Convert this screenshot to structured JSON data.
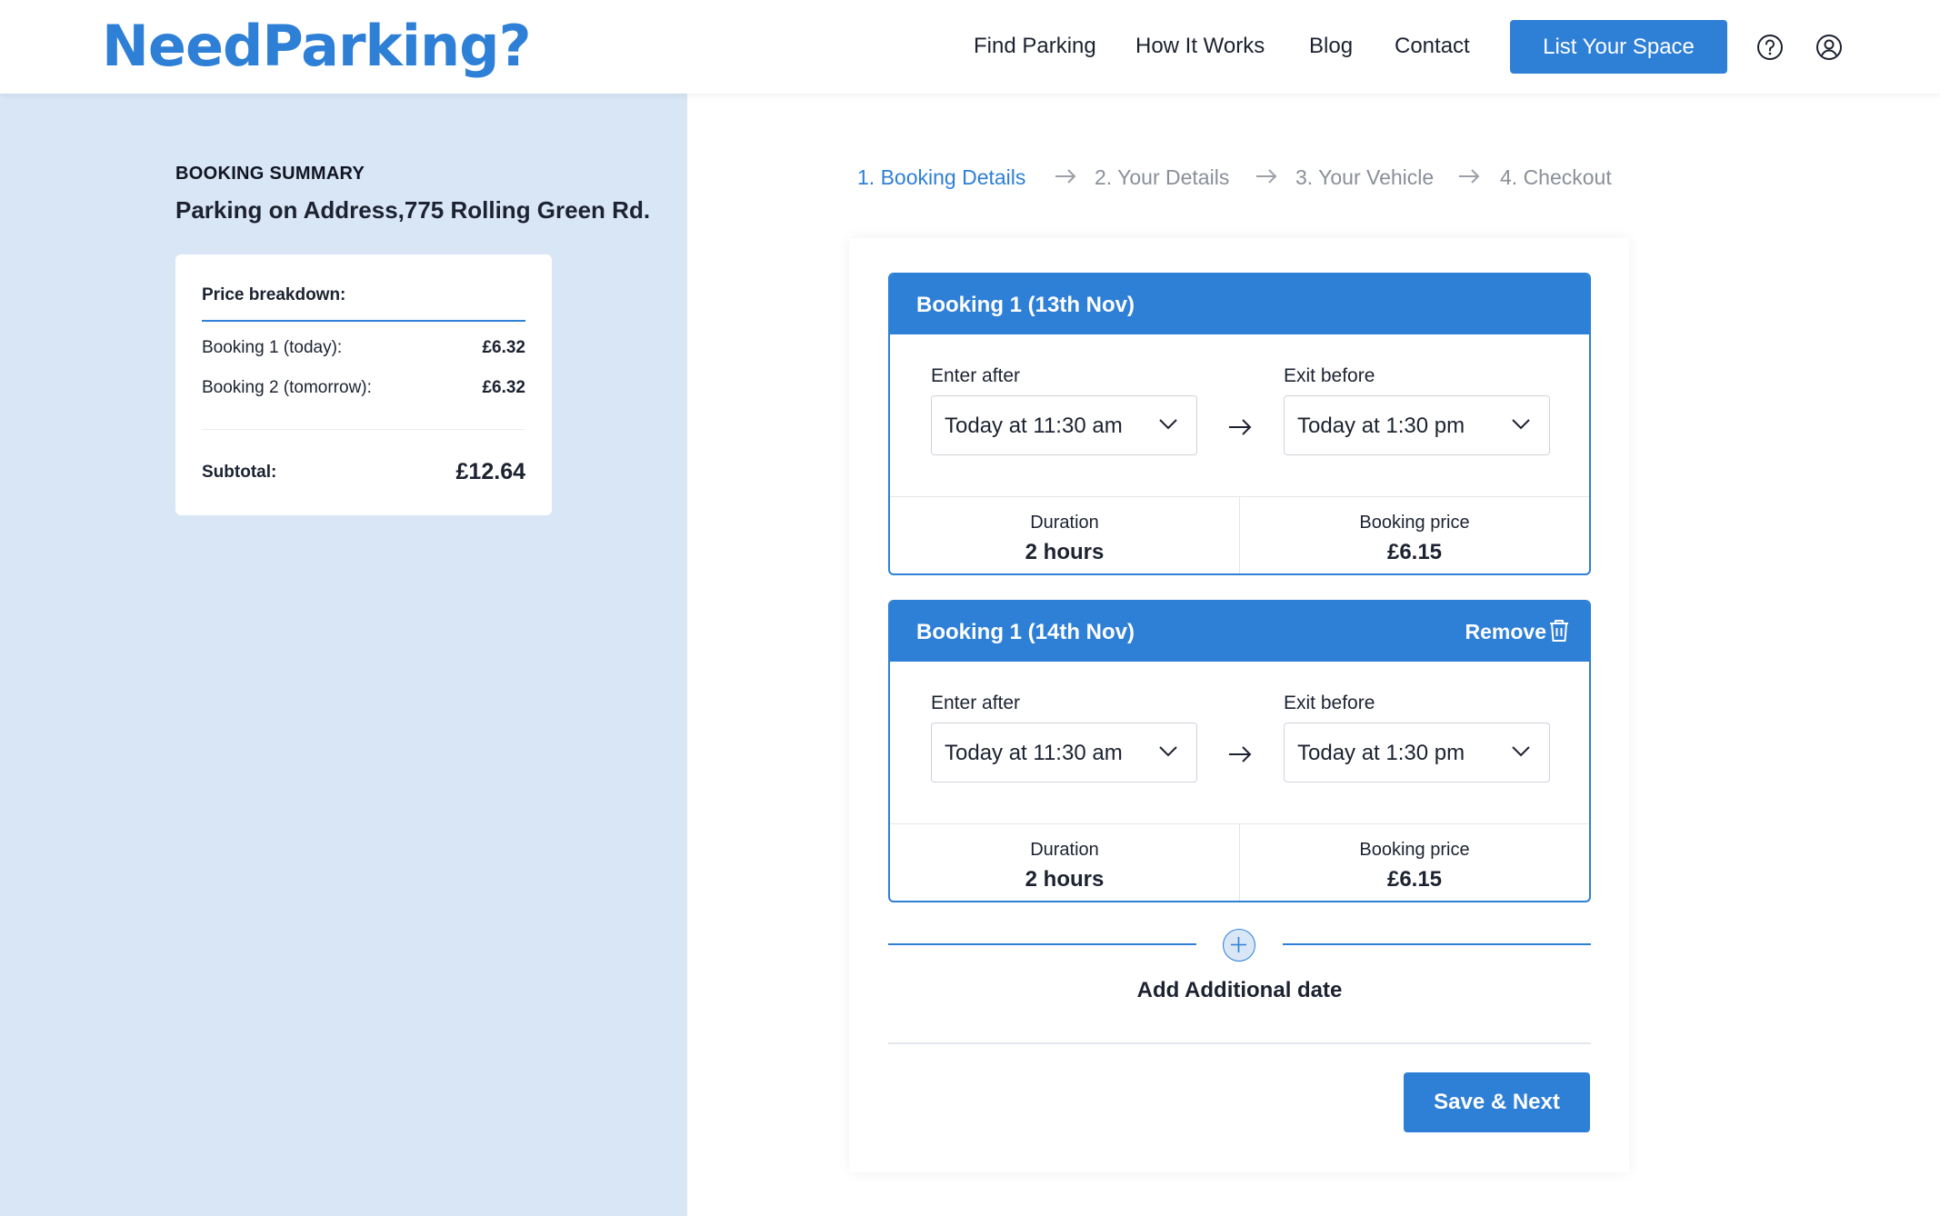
{
  "header": {
    "logo": "NeedParking?",
    "nav": [
      "Find Parking",
      "How It Works",
      "Blog",
      "Contact"
    ],
    "cta": "List Your Space",
    "icons": [
      "help-icon",
      "account-icon"
    ]
  },
  "summary": {
    "label": "BOOKING SUMMARY",
    "address": "Parking on Address,775 Rolling Green Rd.",
    "breakdown_title": "Price breakdown:",
    "rows": [
      {
        "label": "Booking 1 (today):",
        "value": "£6.32"
      },
      {
        "label": "Booking 2 (tomorrow):",
        "value": "£6.32"
      }
    ],
    "subtotal_label": "Subtotal:",
    "subtotal_value": "£12.64"
  },
  "steps": [
    {
      "label": "1. Booking Details",
      "active": true
    },
    {
      "label": "2. Your Details",
      "active": false
    },
    {
      "label": "3. Your Vehicle",
      "active": false
    },
    {
      "label": "4. Checkout",
      "active": false
    }
  ],
  "bookings": [
    {
      "title": "Booking 1 (13th Nov)",
      "enter_label": "Enter after",
      "enter_value": "Today at 11:30 am",
      "exit_label": "Exit before",
      "exit_value": "Today at 1:30 pm",
      "duration_label": "Duration",
      "duration_value": "2 hours",
      "price_label": "Booking price",
      "price_value": "£6.15"
    },
    {
      "title": "Booking 1 (14th Nov)",
      "remove_label": "Remove",
      "enter_label": "Enter after",
      "enter_value": "Today at 11:30 am",
      "exit_label": "Exit before",
      "exit_value": "Today at 1:30 pm",
      "duration_label": "Duration",
      "duration_value": "2 hours",
      "price_label": "Booking price",
      "price_value": "£6.15"
    }
  ],
  "add_date_label": "Add Additional date",
  "save_label": "Save & Next",
  "colors": {
    "accent": "#2e7fd6",
    "panel": "#d8e6f5"
  }
}
